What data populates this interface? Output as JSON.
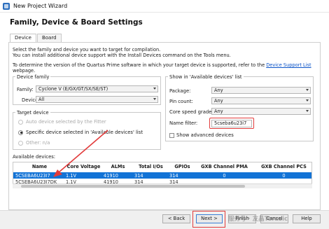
{
  "window": {
    "title": "New Project Wizard"
  },
  "page": {
    "heading": "Family, Device & Board Settings"
  },
  "tabs": [
    {
      "label": "Device"
    },
    {
      "label": "Board"
    }
  ],
  "intro": {
    "line1": "Select the family and device you want to target for compilation.",
    "line2": "You can install additional device support with the Install Devices command on the Tools menu.",
    "line3_prefix": "To determine the version of the Quartus Prime software in which your target device is supported, refer to the ",
    "line3_link": "Device Support List",
    "line3_suffix": " webpage."
  },
  "device_family": {
    "group_label": "Device family",
    "family_label": "Family:",
    "family_value": "Cyclone V (E/GX/GT/SX/SE/ST)",
    "device_label": "Device:",
    "device_value": "All"
  },
  "target_device": {
    "group_label": "Target device",
    "options": [
      {
        "label": "Auto device selected by the Fitter",
        "selected": false,
        "enabled": false
      },
      {
        "label": "Specific device selected in 'Available devices' list",
        "selected": true,
        "enabled": true
      },
      {
        "label": "Other:  n/a",
        "selected": false,
        "enabled": false
      }
    ]
  },
  "show_in_list": {
    "group_label": "Show in 'Available devices' list",
    "package_label": "Package:",
    "package_value": "Any",
    "pin_count_label": "Pin count:",
    "pin_count_value": "Any",
    "speed_label": "Core speed grade:",
    "speed_value": "Any",
    "name_filter_label": "Name filter:",
    "name_filter_value": "5cseba6u23i7",
    "show_advanced_label": "Show advanced devices"
  },
  "available_devices": {
    "label": "Available devices:",
    "columns": [
      "Name",
      "Core Voltage",
      "ALMs",
      "Total I/Os",
      "GPIOs",
      "GXB Channel PMA",
      "GXB Channel PCS"
    ],
    "rows": [
      [
        "5CSEBA6U23I7",
        "1.1V",
        "41910",
        "314",
        "314",
        "0",
        "0"
      ],
      [
        "5CSEBA6U23I7DK",
        "1.1V",
        "41910",
        "314",
        "314",
        "",
        ""
      ]
    ]
  },
  "buttons": {
    "back": "< Back",
    "next": "Next >",
    "finish": "Finish",
    "cancel": "Cancel",
    "help": "Help"
  },
  "watermark": "服务号 · 友晶Terasic",
  "colors": {
    "selection": "#1273d6",
    "annotation": "#e23b3b",
    "link": "#0a53c8"
  }
}
